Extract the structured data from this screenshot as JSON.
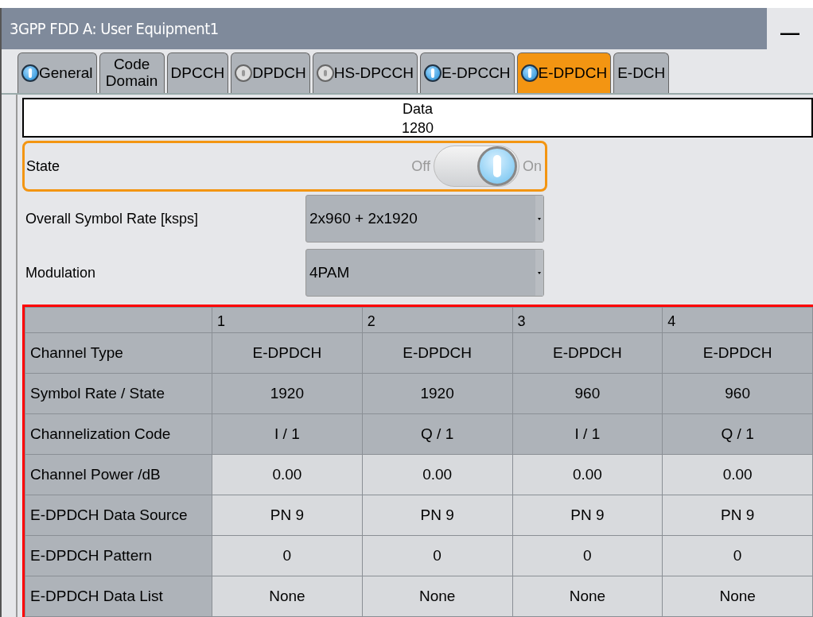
{
  "window": {
    "title": "3GPP FDD A: User Equipment1",
    "minimize": "—"
  },
  "tabs": [
    {
      "label": "General",
      "led_on": true,
      "selected": false
    },
    {
      "label": "Code Domain",
      "selected": false
    },
    {
      "label": "DPCCH",
      "selected": false
    },
    {
      "label": "DPDCH",
      "led_on": false,
      "selected": false
    },
    {
      "label": "HS-DPCCH",
      "led_on": false,
      "selected": false
    },
    {
      "label": "E-DPCCH",
      "led_on": true,
      "selected": false
    },
    {
      "label": "E-DPDCH",
      "led_on": true,
      "selected": true
    },
    {
      "label": "E-DCH",
      "selected": false
    }
  ],
  "header": {
    "title": "Data",
    "value": "1280"
  },
  "state": {
    "label": "State",
    "off_label": "Off",
    "on_label": "On",
    "on": true,
    "focused": true
  },
  "fields": [
    {
      "label": "Overall Symbol Rate [ksps]",
      "value": "2x960 + 2x1920"
    },
    {
      "label": "Modulation",
      "value": "4PAM"
    }
  ],
  "table": {
    "columns": [
      "1",
      "2",
      "3",
      "4"
    ],
    "rows": [
      {
        "label": "Channel Type",
        "readonly": true,
        "cells": [
          "E-DPDCH",
          "E-DPDCH",
          "E-DPDCH",
          "E-DPDCH"
        ]
      },
      {
        "label": "Symbol Rate / State",
        "readonly": true,
        "cells": [
          "1920",
          "1920",
          "960",
          "960"
        ]
      },
      {
        "label": "Channelization Code",
        "readonly": true,
        "cells": [
          "I / 1",
          "Q / 1",
          "I / 1",
          "Q / 1"
        ]
      },
      {
        "label": "Channel Power /dB",
        "readonly": false,
        "cells": [
          "0.00",
          "0.00",
          "0.00",
          "0.00"
        ]
      },
      {
        "label": "E-DPDCH Data Source",
        "readonly": false,
        "cells": [
          "PN 9",
          "PN 9",
          "PN 9",
          "PN 9"
        ]
      },
      {
        "label": "E-DPDCH Pattern",
        "readonly": false,
        "cells": [
          "0",
          "0",
          "0",
          "0"
        ]
      },
      {
        "label": "E-DPDCH Data List",
        "readonly": false,
        "cells": [
          "None",
          "None",
          "None",
          "None"
        ]
      }
    ]
  }
}
